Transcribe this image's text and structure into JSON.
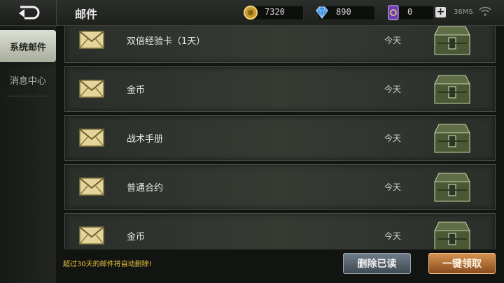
{
  "header": {
    "title": "邮件",
    "gold": "7320",
    "diamonds": "890",
    "cards": "0",
    "ping": "36MS"
  },
  "sidebar": {
    "items": [
      {
        "label": "系统邮件",
        "active": true
      },
      {
        "label": "消息中心",
        "active": false
      }
    ]
  },
  "mails": [
    {
      "title": "双倍经验卡（1天）",
      "date": "今天"
    },
    {
      "title": "金币",
      "date": "今天"
    },
    {
      "title": "战术手册",
      "date": "今天"
    },
    {
      "title": "普通合约",
      "date": "今天"
    },
    {
      "title": "金币",
      "date": "今天"
    }
  ],
  "footer": {
    "notice": "超过30天的邮件将自动删除!",
    "delete_read": "删除已读",
    "claim_all": "一键领取"
  },
  "colors": {
    "accent_gold": "#e8c63c",
    "claim_button": "#c07a3a",
    "delete_button": "#5a6772"
  }
}
